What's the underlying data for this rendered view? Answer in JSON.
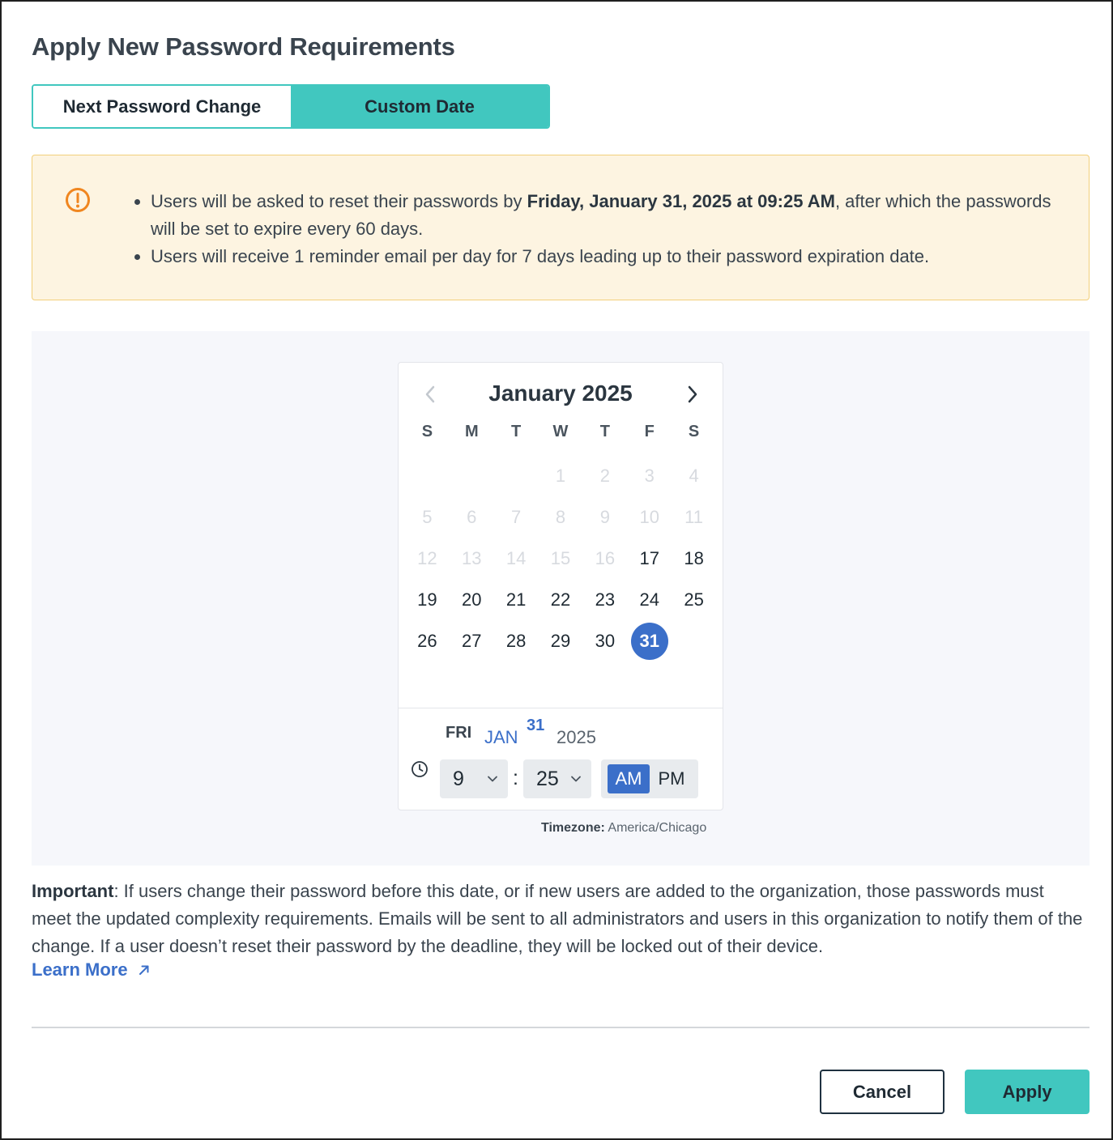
{
  "dialog": {
    "title": "Apply New Password Requirements"
  },
  "segmented": {
    "options": [
      "Next Password Change",
      "Custom Date"
    ],
    "selected": "Custom Date"
  },
  "alert": {
    "icon": "warning-circle-icon",
    "color": "#f0861f",
    "bullet1_pre": "Users will be asked to reset their passwords by ",
    "bullet1_bold": "Friday, January 31, 2025 at 09:25 AM",
    "bullet1_post": ", after which the passwords will be set to expire every 60 days.",
    "bullet2": "Users will receive 1 reminder email per day for 7 days leading up to their password expiration date."
  },
  "calendar": {
    "month_label": "January 2025",
    "weekdays": [
      "S",
      "M",
      "T",
      "W",
      "T",
      "F",
      "S"
    ],
    "leading_blanks": 3,
    "days": [
      {
        "d": "1",
        "enabled": false
      },
      {
        "d": "2",
        "enabled": false
      },
      {
        "d": "3",
        "enabled": false
      },
      {
        "d": "4",
        "enabled": false
      },
      {
        "d": "5",
        "enabled": false
      },
      {
        "d": "6",
        "enabled": false
      },
      {
        "d": "7",
        "enabled": false
      },
      {
        "d": "8",
        "enabled": false
      },
      {
        "d": "9",
        "enabled": false
      },
      {
        "d": "10",
        "enabled": false
      },
      {
        "d": "11",
        "enabled": false
      },
      {
        "d": "12",
        "enabled": false
      },
      {
        "d": "13",
        "enabled": false
      },
      {
        "d": "14",
        "enabled": false
      },
      {
        "d": "15",
        "enabled": false
      },
      {
        "d": "16",
        "enabled": false
      },
      {
        "d": "17",
        "enabled": true
      },
      {
        "d": "18",
        "enabled": true
      },
      {
        "d": "19",
        "enabled": true
      },
      {
        "d": "20",
        "enabled": true
      },
      {
        "d": "21",
        "enabled": true
      },
      {
        "d": "22",
        "enabled": true
      },
      {
        "d": "23",
        "enabled": true
      },
      {
        "d": "24",
        "enabled": true
      },
      {
        "d": "25",
        "enabled": true
      },
      {
        "d": "26",
        "enabled": true
      },
      {
        "d": "27",
        "enabled": true
      },
      {
        "d": "28",
        "enabled": true
      },
      {
        "d": "29",
        "enabled": true
      },
      {
        "d": "30",
        "enabled": true
      },
      {
        "d": "31",
        "enabled": true,
        "selected": true
      }
    ],
    "selected_date": {
      "weekday": "FRI",
      "month": "JAN",
      "day": "31",
      "year": "2025"
    },
    "time": {
      "hour": "9",
      "minute": "25",
      "separator": ":",
      "am_label": "AM",
      "pm_label": "PM",
      "period": "AM"
    },
    "accent_color": "#3b6fc9"
  },
  "timezone": {
    "label": "Timezone:",
    "value": " America/Chicago"
  },
  "important": {
    "label": "Important",
    "text": ": If users change their password before this date, or if new users are added to the organization, those passwords must meet the updated complexity requirements. Emails will be sent to all administrators and users in this organization to notify them of the change. If a user doesn’t reset their password by the deadline, they will be locked out of their device.",
    "link_label": "Learn More"
  },
  "footer": {
    "cancel_label": "Cancel",
    "apply_label": "Apply",
    "primary_color": "#41c7bf"
  }
}
